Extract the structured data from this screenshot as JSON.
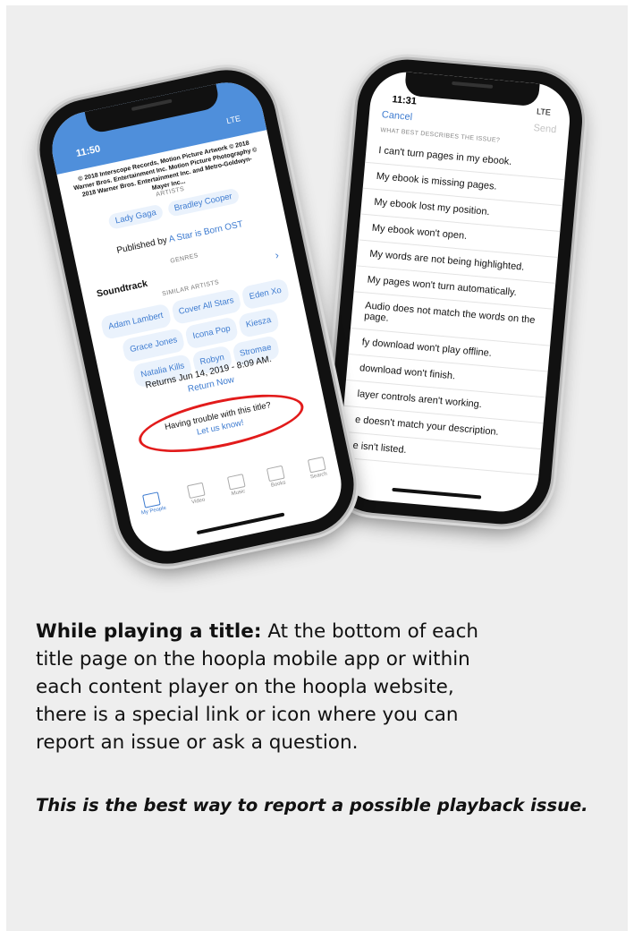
{
  "back_phone": {
    "time": "11:31",
    "signal": "LTE",
    "cancel": "Cancel",
    "send": "Send",
    "section_label": "WHAT BEST DESCRIBES THE ISSUE?",
    "issues": [
      "I can't turn pages in my ebook.",
      "My ebook is missing pages.",
      "My ebook lost my position.",
      "My ebook won't open.",
      "My words are not being highlighted.",
      "My pages won't turn automatically.",
      "Audio does not match the words on the page.",
      "fy download won't play offline.",
      "download won't finish.",
      "layer controls aren't working.",
      "e doesn't match your description.",
      "e isn't listed."
    ]
  },
  "front_phone": {
    "time": "11:50",
    "signal": "LTE",
    "copyright": "© 2018 Interscope Records, Motion Picture Artwork © 2018 Warner Bros. Entertainment Inc. Motion Picture Photography © 2018 Warner Bros. Entertainment Inc. and Metro-Goldwyn-Mayer Inc...",
    "artists_label": "ARTISTS",
    "artists": [
      "Lady Gaga",
      "Bradley Cooper"
    ],
    "published_prefix": "Published by",
    "publisher": "A Star is Born OST",
    "genres_label": "GENRES",
    "genre": "Soundtrack",
    "similar_label": "SIMILAR ARTISTS",
    "similar_artists": [
      "Adam Lambert",
      "Cover All Stars",
      "Eden Xo",
      "Grace Jones",
      "Icona Pop",
      "Kiesza",
      "Natalia Kills",
      "Robyn",
      "Stromae"
    ],
    "returns": "Returns Jun 14, 2019 - 8:09 AM.",
    "return_now": "Return Now",
    "trouble_text": "Having trouble with this title?",
    "trouble_link": "Let us know!",
    "tabs": [
      "My People",
      "Video",
      "Music",
      "Books",
      "Search"
    ]
  },
  "caption": {
    "bold": "While playing a title:",
    "line1": "At the bottom of each",
    "line2": "title page on the hoopla mobile app or within",
    "line3": "each content player on the hoopla website,",
    "line4": "there is a special link or icon where you can",
    "line5": "report an issue or ask a question."
  },
  "tagline": "This is the best way to report a possible playback issue.",
  "colors": {
    "accent": "#4f8fdb",
    "highlight": "#e21b1b"
  }
}
